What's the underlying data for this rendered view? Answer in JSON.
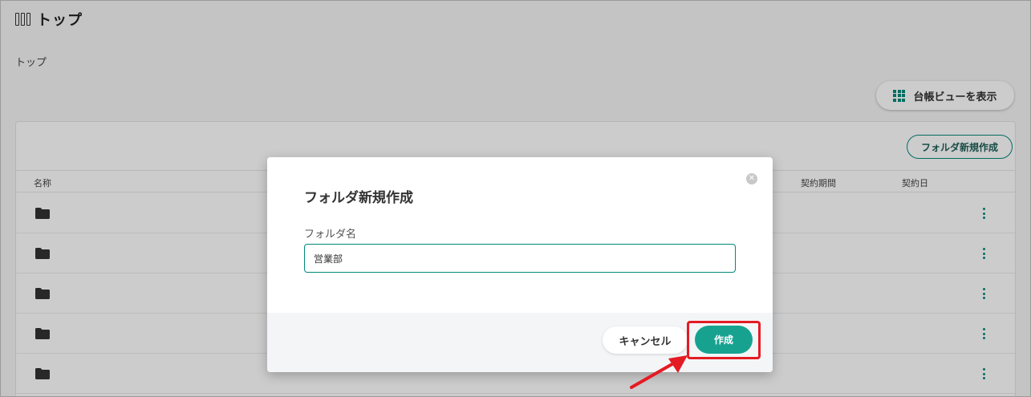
{
  "header": {
    "title": "トップ",
    "icon": "books-icon"
  },
  "breadcrumb": "トップ",
  "toolbar": {
    "ledger_view_label": "台帳ビューを表示",
    "ledger_view_icon": "grid-icon"
  },
  "card": {
    "new_folder_label": "フォルダ新規作成"
  },
  "table": {
    "columns": [
      "名称",
      "契約期間",
      "契約日"
    ],
    "row_count": 5
  },
  "modal": {
    "title": "フォルダ新規作成",
    "field_label": "フォルダ名",
    "field_value": "営業部",
    "cancel_label": "キャンセル",
    "create_label": "作成"
  },
  "colors": {
    "accent": "#17a290",
    "highlight": "#e41b23"
  }
}
